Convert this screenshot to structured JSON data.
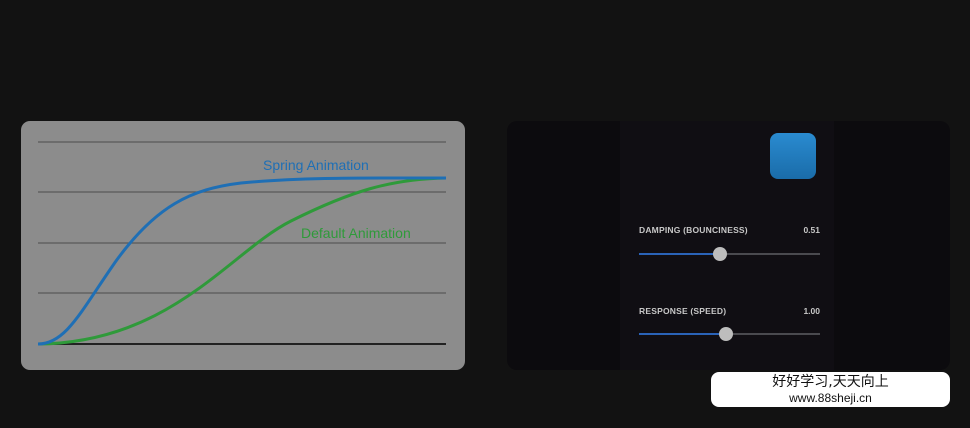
{
  "chart": {
    "spring_label": "Spring Animation",
    "default_label": "Default Animation",
    "colors": {
      "background": "#8c8c8c",
      "spring": "#1f6fb5",
      "default": "#2f9a3a",
      "grid": "#5a5a5a"
    }
  },
  "controls": {
    "damping": {
      "label": "DAMPING (BOUNCINESS)",
      "value": "0.51",
      "level": 0.45
    },
    "response": {
      "label": "RESPONSE (SPEED)",
      "value": "1.00",
      "level": 0.48
    },
    "preview_color": "#2080c4"
  },
  "watermark": {
    "line1": "好好学习,天天向上",
    "line2": "www.88sheji.cn"
  }
}
